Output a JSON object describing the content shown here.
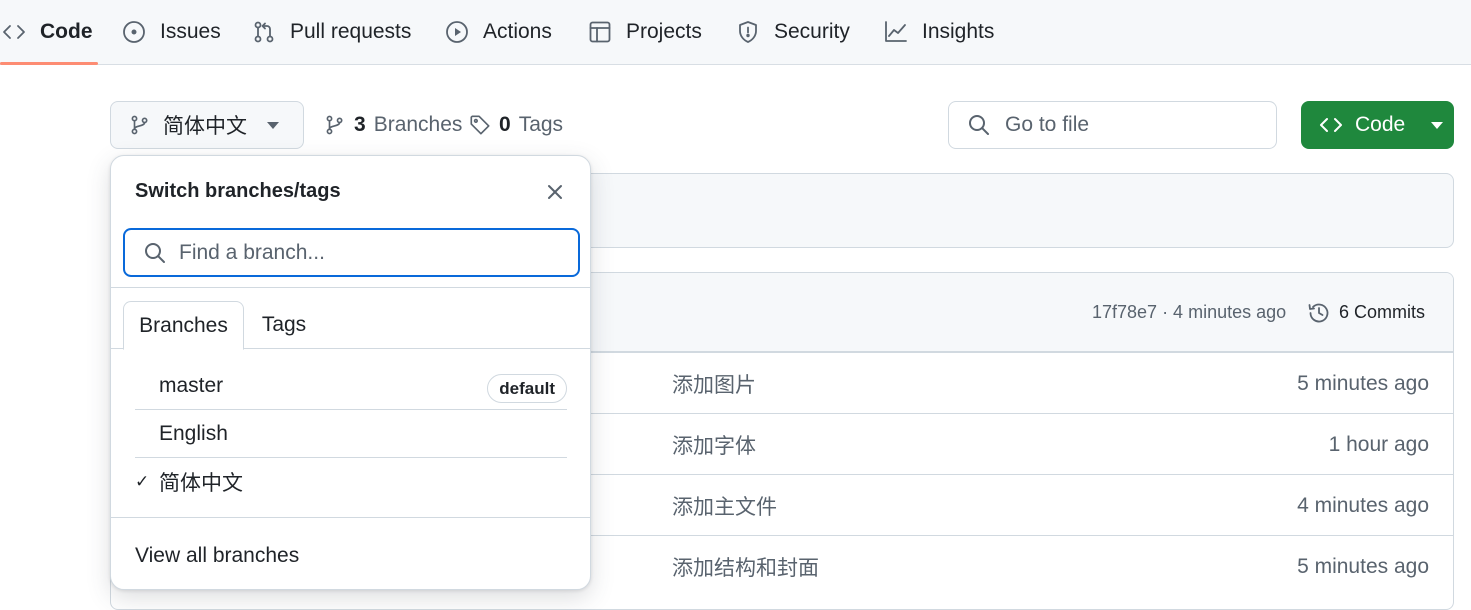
{
  "repo_nav": {
    "items": [
      {
        "label": "Code",
        "icon": "code-icon",
        "selected": true
      },
      {
        "label": "Issues",
        "icon": "issue-icon"
      },
      {
        "label": "Pull requests",
        "icon": "pull-request-icon"
      },
      {
        "label": "Actions",
        "icon": "play-icon"
      },
      {
        "label": "Projects",
        "icon": "table-icon"
      },
      {
        "label": "Security",
        "icon": "shield-icon"
      },
      {
        "label": "Insights",
        "icon": "graph-icon"
      }
    ],
    "accent_color": "#fd8c73"
  },
  "toolbar": {
    "current_branch": "简体中文",
    "branches_count": "3",
    "branches_label": "Branches",
    "tags_count": "0",
    "tags_label": "Tags",
    "go_to_file_placeholder": "Go to file",
    "code_button_label": "Code",
    "code_button_color": "#1f883d"
  },
  "files_header": {
    "commit_meta": "17f78e7 · 4 minutes ago",
    "commits_label": "6 Commits"
  },
  "file_rows": [
    {
      "message": "添加图片",
      "time": "5 minutes ago"
    },
    {
      "message": "添加字体",
      "time": "1 hour ago"
    },
    {
      "message": "添加主文件",
      "time": "4 minutes ago"
    },
    {
      "message": "添加结构和封面",
      "time": "5 minutes ago"
    }
  ],
  "dropdown": {
    "title": "Switch branches/tags",
    "search_placeholder": "Find a branch...",
    "tabs": [
      "Branches",
      "Tags"
    ],
    "branches": [
      {
        "name": "master",
        "badge": "default",
        "checked": false
      },
      {
        "name": "English",
        "badge": "",
        "checked": false
      },
      {
        "name": "简体中文",
        "badge": "",
        "checked": true
      }
    ],
    "check_mark": "✓",
    "footer_link": "View all branches"
  }
}
